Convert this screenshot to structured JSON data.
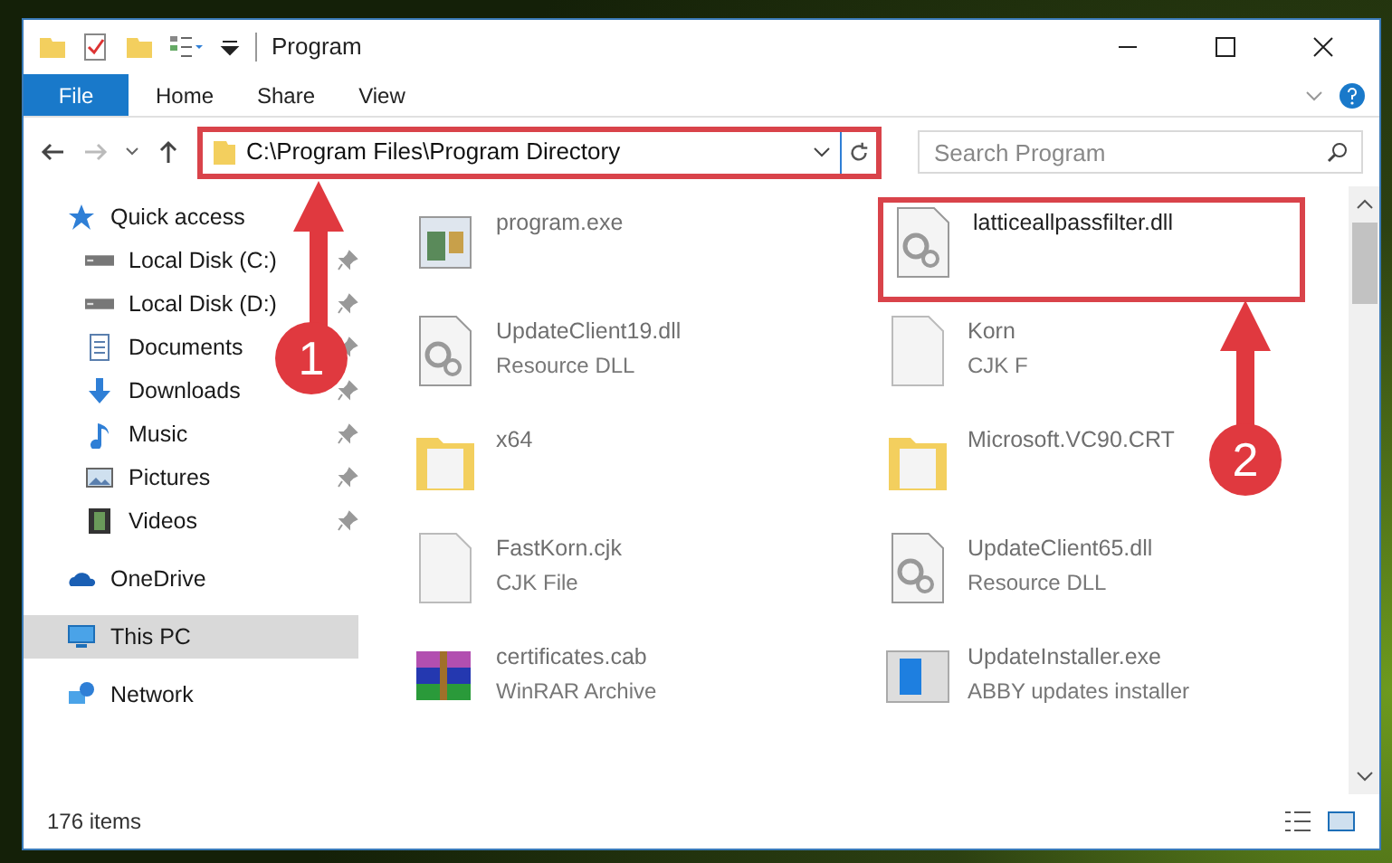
{
  "window": {
    "title": "Program"
  },
  "ribbon_tabs": [
    {
      "label": "File",
      "selected": true
    },
    {
      "label": "Home",
      "selected": false
    },
    {
      "label": "Share",
      "selected": false
    },
    {
      "label": "View",
      "selected": false
    }
  ],
  "address": {
    "value": "C:\\Program Files\\Program Directory",
    "highlighted": true
  },
  "search": {
    "placeholder": "Search Program"
  },
  "sidebar": {
    "items": [
      {
        "label": "Quick access",
        "kind": "star",
        "selected": false,
        "children": [
          {
            "label": "Local Disk (C:)",
            "kind": "disk",
            "pinned": true,
            "selected": false
          },
          {
            "label": "Local Disk (D:)",
            "kind": "disk",
            "pinned": true,
            "selected": false
          },
          {
            "label": "Documents",
            "kind": "document",
            "pinned": true,
            "selected": false
          },
          {
            "label": "Downloads",
            "kind": "download",
            "pinned": true,
            "selected": false
          },
          {
            "label": "Music",
            "kind": "music",
            "pinned": true,
            "selected": false
          },
          {
            "label": "Pictures",
            "kind": "pictures",
            "pinned": true,
            "selected": false
          },
          {
            "label": "Videos",
            "kind": "video",
            "pinned": true,
            "selected": false
          }
        ]
      },
      {
        "label": "OneDrive",
        "kind": "cloud",
        "selected": false
      },
      {
        "label": "This PC",
        "kind": "pc",
        "selected": true
      },
      {
        "label": "Network",
        "kind": "network",
        "selected": false
      }
    ]
  },
  "files": [
    {
      "name": "program.exe",
      "kind": "exe",
      "highlighted": false
    },
    {
      "name": "latticeallpassfilter.dll",
      "kind": "dll",
      "highlighted": true
    },
    {
      "name": "UpdateClient19.dll",
      "type": "Resource DLL",
      "kind": "dll",
      "highlighted": false
    },
    {
      "name": "Korn",
      "type": "CJK F",
      "kind": "file",
      "highlighted": false
    },
    {
      "name": "x64",
      "kind": "folder",
      "highlighted": false
    },
    {
      "name": "Microsoft.VC90.CRT",
      "kind": "folder",
      "highlighted": false
    },
    {
      "name": "FastKorn.cjk",
      "type": "CJK File",
      "kind": "file",
      "highlighted": false
    },
    {
      "name": "UpdateClient65.dll",
      "type": "Resource DLL",
      "kind": "dll",
      "highlighted": false
    },
    {
      "name": "certificates.cab",
      "type": "WinRAR Archive",
      "kind": "cab",
      "highlighted": false
    },
    {
      "name": "UpdateInstaller.exe",
      "type": "ABBY updates installer",
      "kind": "installer",
      "highlighted": false
    }
  ],
  "status_bar": {
    "count": "176 items"
  },
  "callouts": [
    {
      "number": "1"
    },
    {
      "number": "2"
    }
  ]
}
